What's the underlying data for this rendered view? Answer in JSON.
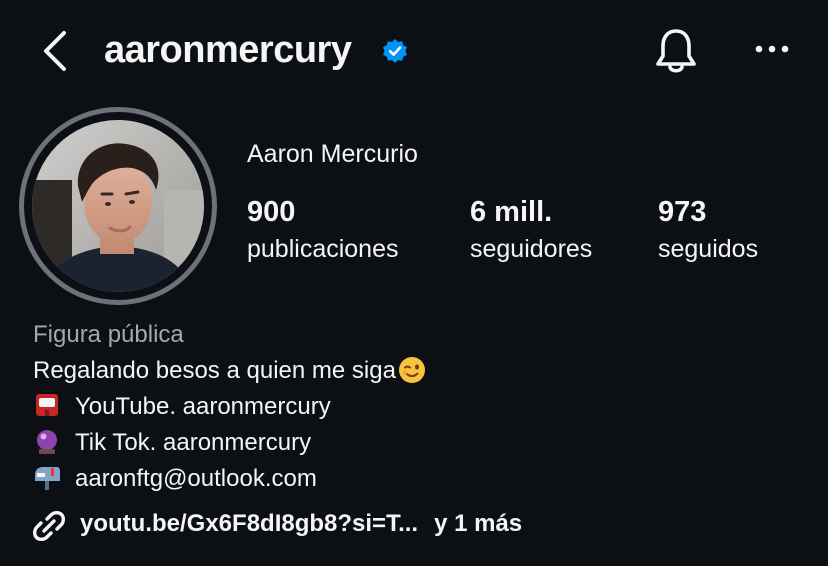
{
  "header": {
    "username": "aaronmercury",
    "verified": true,
    "icons": [
      "back-icon",
      "verified-badge-icon",
      "bell-icon",
      "more-icon"
    ],
    "accent_color": "#0095f6"
  },
  "profile": {
    "display_name": "Aaron Mercurio",
    "stats": [
      {
        "value": "900",
        "label": "publicaciones"
      },
      {
        "value": "6 mill.",
        "label": "seguidores"
      },
      {
        "value": "973",
        "label": "seguidos"
      }
    ]
  },
  "bio": {
    "category": "Figura pública",
    "line1": "Regalando besos a quien me siga",
    "youtube": "YouTube. aaronmercury",
    "tiktok": "Tik Tok. aaronmercury",
    "email": "aaronftg@outlook.com"
  },
  "link": {
    "url": "youtu.be/Gx6F8dI8gb8?si=T...",
    "more": "y 1 más"
  },
  "colors": {
    "background": "#0c1014",
    "text": "#f5f5f5",
    "muted": "#a8a8a8",
    "ring": "#6e7177"
  }
}
